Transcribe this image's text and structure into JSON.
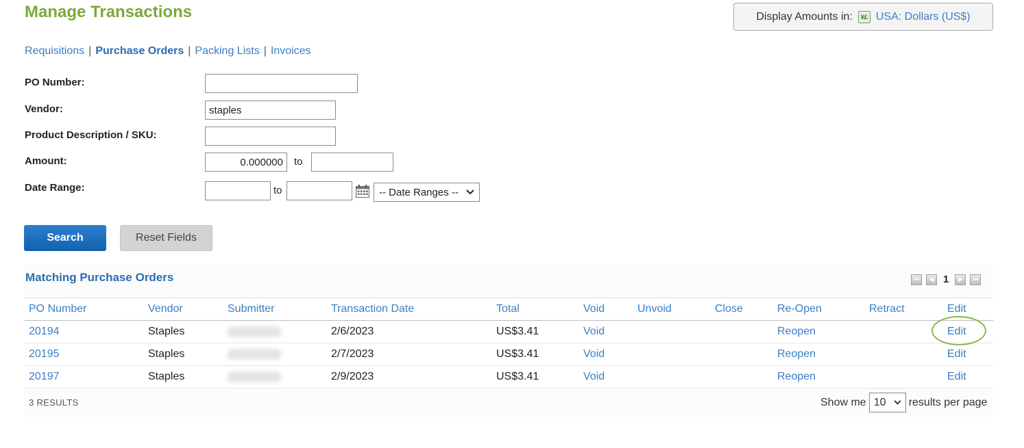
{
  "page": {
    "title": "Manage Transactions"
  },
  "currency": {
    "label": "Display Amounts in:",
    "icon": "currency-exchange-icon",
    "value": "USA: Dollars (US$)"
  },
  "subnav": {
    "items": [
      {
        "label": "Requisitions",
        "active": false
      },
      {
        "label": "Purchase Orders",
        "active": true
      },
      {
        "label": "Packing Lists",
        "active": false
      },
      {
        "label": "Invoices",
        "active": false
      }
    ],
    "separator": "|"
  },
  "form": {
    "po_number": {
      "label": "PO Number:",
      "value": ""
    },
    "vendor": {
      "label": "Vendor:",
      "value": "staples"
    },
    "product": {
      "label": "Product Description / SKU:",
      "value": ""
    },
    "amount": {
      "label": "Amount:",
      "from": "0.000000",
      "to_label": "to",
      "to": ""
    },
    "date_range": {
      "label": "Date Range:",
      "from": "",
      "to_label": "to",
      "to": "",
      "preset": "-- Date Ranges --"
    }
  },
  "buttons": {
    "search": "Search",
    "reset": "Reset Fields"
  },
  "results": {
    "title": "Matching Purchase Orders",
    "current_page": "1",
    "columns": [
      "PO Number",
      "Vendor",
      "Submitter",
      "Transaction Date",
      "Total",
      "Void",
      "Unvoid",
      "Close",
      "Re-Open",
      "Retract",
      "Edit"
    ],
    "rows": [
      {
        "po": "20194",
        "vendor": "Staples",
        "date": "2/6/2023",
        "total": "US$3.41",
        "void": "Void",
        "reopen": "Reopen",
        "edit": "Edit"
      },
      {
        "po": "20195",
        "vendor": "Staples",
        "date": "2/7/2023",
        "total": "US$3.41",
        "void": "Void",
        "reopen": "Reopen",
        "edit": "Edit"
      },
      {
        "po": "20197",
        "vendor": "Staples",
        "date": "2/9/2023",
        "total": "US$3.41",
        "void": "Void",
        "reopen": "Reopen",
        "edit": "Edit"
      }
    ],
    "count_text": "3 RESULTS",
    "per_page": {
      "prefix": "Show me",
      "value": "10",
      "suffix": "results per page"
    }
  }
}
